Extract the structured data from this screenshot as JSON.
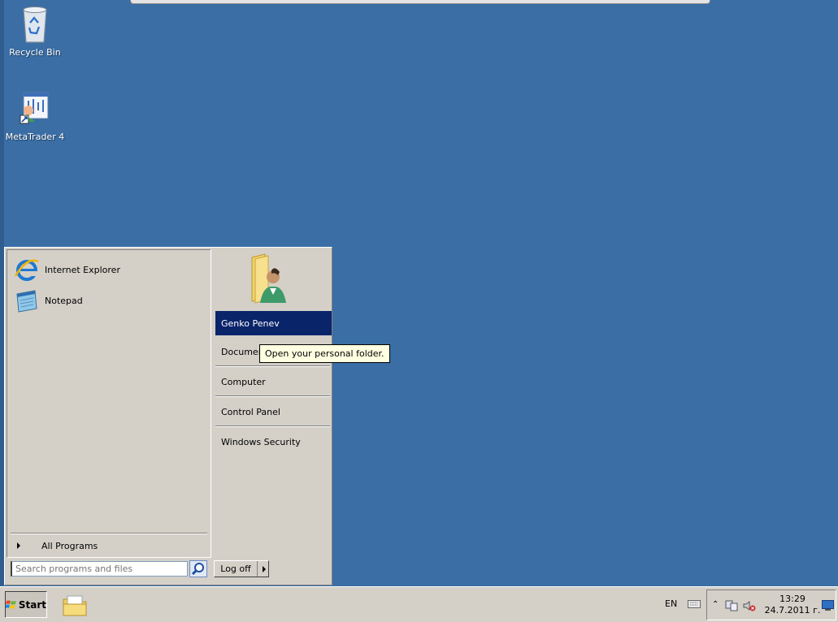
{
  "desktop": {
    "icons": [
      {
        "label": "Recycle Bin",
        "icon": "recycle-bin-icon"
      },
      {
        "label": "MetaTrader 4",
        "icon": "metatrader-icon"
      }
    ]
  },
  "start_menu": {
    "programs": [
      {
        "label": "Internet Explorer",
        "icon": "internet-explorer-icon"
      },
      {
        "label": "Notepad",
        "icon": "notepad-icon"
      }
    ],
    "all_programs": "All Programs",
    "search_placeholder": "Search programs and files",
    "search_value": "",
    "right_items": [
      {
        "label": "Genko Penev",
        "selected": true
      },
      {
        "label": "Documents",
        "selected": false
      },
      {
        "label": "Computer",
        "selected": false
      },
      {
        "label": "Control Panel",
        "selected": false
      },
      {
        "label": "Windows Security",
        "selected": false
      }
    ],
    "logoff_label": "Log off",
    "tooltip": "Open your personal folder."
  },
  "taskbar": {
    "start_label": "Start",
    "language": "EN",
    "time": "13:29",
    "date": "24.7.2011 г."
  },
  "colors": {
    "desktop": "#3a6ea5",
    "selection": "#0a246a",
    "tooltip_bg": "#ffffe1",
    "chrome": "#d4d0c8"
  }
}
